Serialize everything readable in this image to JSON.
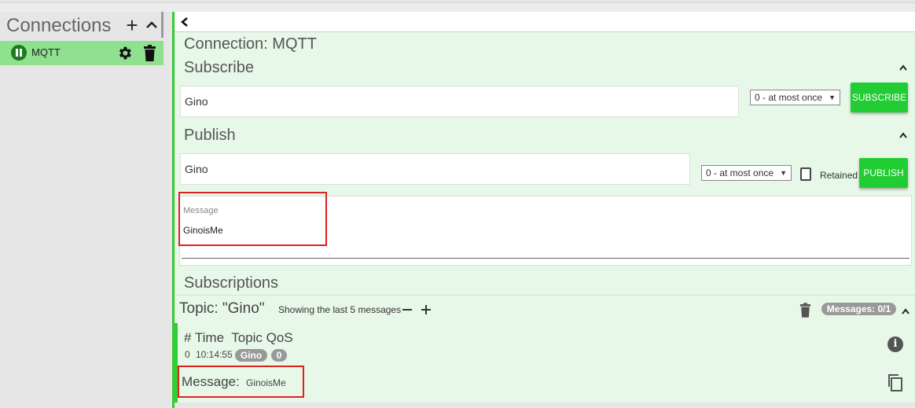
{
  "sidebar": {
    "title": "Connections",
    "add_icon": "plus-icon",
    "collapse_icon": "chevron-up-icon",
    "connection": {
      "name": "MQTT",
      "status_icon": "pause-icon",
      "settings_icon": "gear-icon",
      "delete_icon": "trash-icon"
    }
  },
  "main": {
    "back_icon": "chevron-left-icon",
    "connection_title": "Connection: MQTT",
    "subscribe": {
      "title": "Subscribe",
      "topic_value": "Gino",
      "qos_value": "0 - at most once",
      "button_label": "SUBSCRIBE"
    },
    "publish": {
      "title": "Publish",
      "topic_value": "Gino",
      "qos_value": "0 - at most once",
      "retained_label": "Retained",
      "button_label": "PUBLISH",
      "message_label": "Message",
      "message_value": "GinoisMe"
    },
    "subscriptions": {
      "title": "Subscriptions",
      "topic_label": "Topic: \"Gino\"",
      "showing_text": "Showing the last 5 messages",
      "messages_badge": "Messages: 0/1",
      "columns": [
        "#",
        "Time",
        "Topic",
        "QoS"
      ],
      "row": {
        "index": "0",
        "time": "10:14:55",
        "topic": "Gino",
        "qos": "0"
      },
      "message_label": "Message:",
      "message_value": "GinoisMe"
    }
  },
  "colors": {
    "accent_green": "#22cc33",
    "connection_active": "#8fe08f",
    "highlight_red": "#dd2222"
  }
}
